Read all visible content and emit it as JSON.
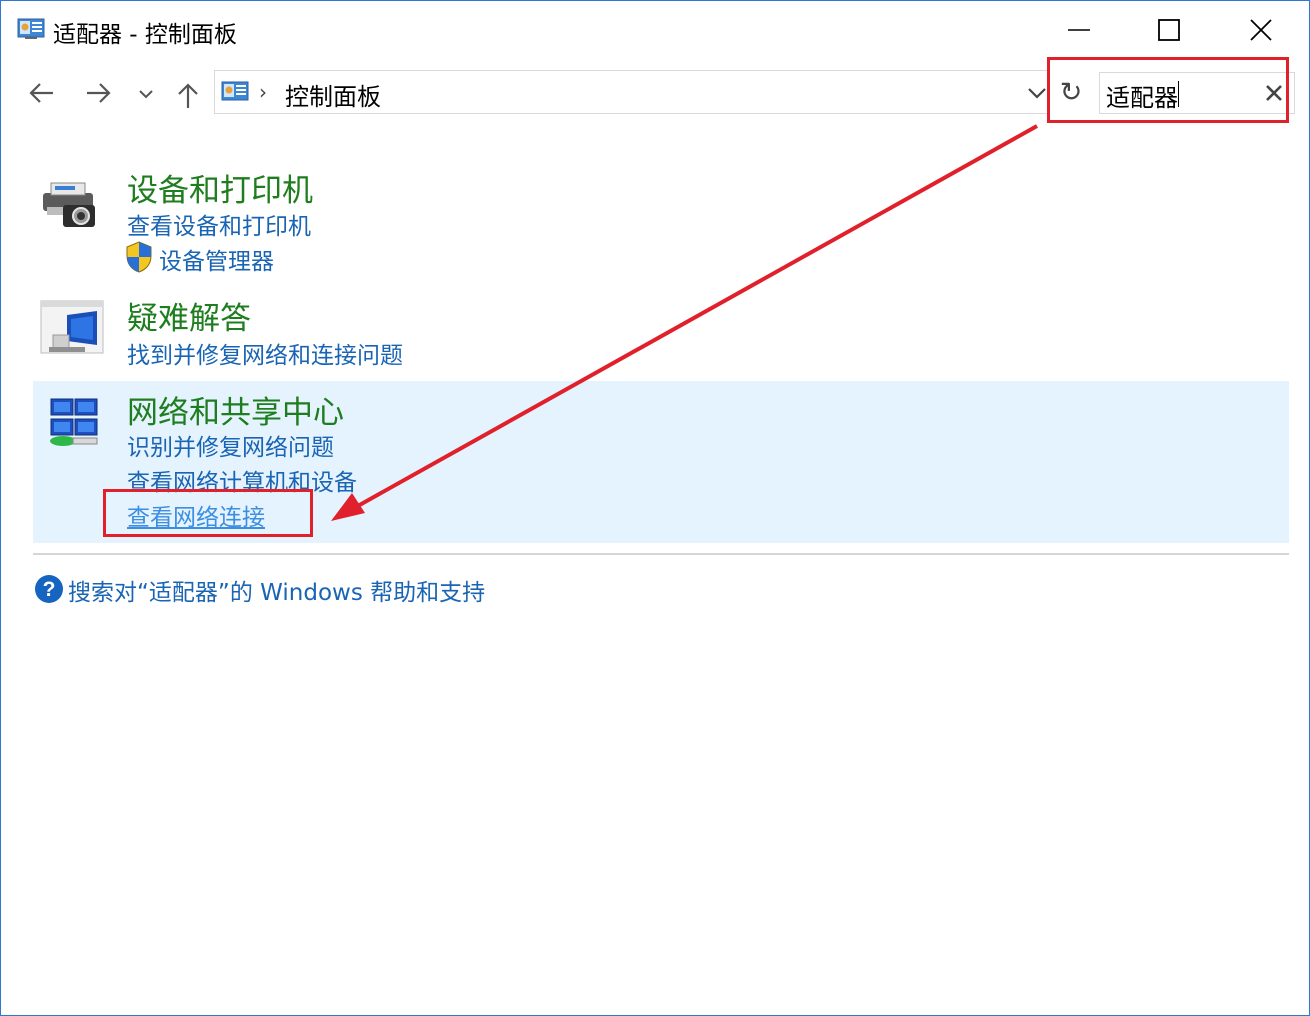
{
  "window": {
    "title": "适配器 - 控制面板",
    "icon": "control-panel-icon"
  },
  "nav": {
    "back_icon": "back-arrow-icon",
    "forward_icon": "forward-arrow-icon",
    "recent_icon": "chevron-down-icon",
    "up_icon": "up-arrow-icon",
    "breadcrumb_sep": "›",
    "breadcrumb": "控制面板",
    "refresh_symbol": "↻"
  },
  "search": {
    "value": "适配器",
    "clear_icon": "close-icon"
  },
  "groups": [
    {
      "title": "设备和打印机",
      "icon": "printer-camera-icon",
      "links": [
        "查看设备和打印机",
        "设备管理器"
      ]
    },
    {
      "title": "疑难解答",
      "icon": "troubleshooting-icon",
      "links": [
        "找到并修复网络和连接问题"
      ]
    },
    {
      "title": "网络和共享中心",
      "icon": "network-center-icon",
      "links": [
        "识别并修复网络问题",
        "查看网络计算机和设备",
        "查看网络连接"
      ]
    }
  ],
  "help": {
    "text": "搜索对“适配器”的 Windows 帮助和支持",
    "icon": "help-icon"
  },
  "colors": {
    "title_green": "#1e7d1e",
    "link_blue": "#1a64b4",
    "highlight": "#e5f3fe",
    "annotation_red": "#e0202a"
  }
}
